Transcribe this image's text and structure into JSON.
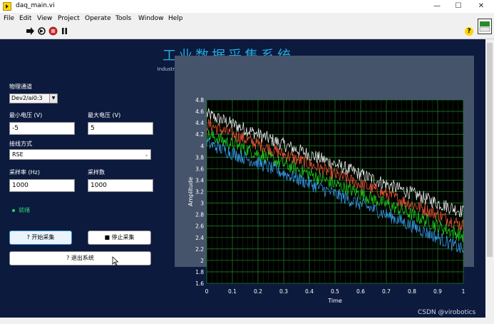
{
  "window": {
    "title": "daq_main.vi",
    "minimize": "—",
    "maximize": "☐",
    "close": "✕"
  },
  "menu": [
    "File",
    "Edit",
    "View",
    "Project",
    "Operate",
    "Tools",
    "Window",
    "Help"
  ],
  "toolbar": {
    "icons": [
      "run-arrow-icon",
      "run-continuously-icon",
      "abort-icon",
      "pause-icon"
    ],
    "help": "?"
  },
  "header": {
    "title": "工业数据采集系统",
    "subtitle": "Industrial DAQ System  |  DAQmx Analog Input"
  },
  "channel": {
    "label": "物理通道",
    "value": "Dev2/ai0:3"
  },
  "min_voltage": {
    "label": "最小电压 (V)",
    "value": "-5"
  },
  "max_voltage": {
    "label": "最大电压 (V)",
    "value": "5"
  },
  "terminal": {
    "label": "接线方式",
    "value": "RSE"
  },
  "sample_rate": {
    "label": "采样率 (Hz)",
    "value": "1000"
  },
  "samples": {
    "label": "采样数",
    "value": "1000"
  },
  "status": {
    "text": "就绪"
  },
  "buttons": {
    "start": "? 开始采集",
    "stop": "■ 停止采集",
    "exit": "? 退出系统"
  },
  "watermark": "CSDN @virobotics",
  "colors": {
    "panel_bg": "#0c1a3d",
    "title": "#26a9e0",
    "plot_bg": "#000000",
    "grid": "#1f7a2a"
  },
  "chart_data": {
    "type": "line",
    "title": "",
    "xlabel": "Time",
    "ylabel": "Amplitude",
    "xlim": [
      0,
      1
    ],
    "ylim": [
      1.6,
      4.8
    ],
    "xticks": [
      "0",
      "0.1",
      "0.2",
      "0.3",
      "0.4",
      "0.5",
      "0.6",
      "0.7",
      "0.8",
      "0.9",
      "1"
    ],
    "yticks": [
      "4.8",
      "4.6",
      "4.4",
      "4.2",
      "4",
      "3.8",
      "3.6",
      "3.4",
      "3.2",
      "3",
      "2.8",
      "2.6",
      "2.4",
      "2.2",
      "2",
      "1.8",
      "1.6"
    ],
    "grid": true,
    "noise": 0.12,
    "series": [
      {
        "color": "#ffffff",
        "x": [
          0,
          0.1,
          0.2,
          0.3,
          0.4,
          0.5,
          0.6,
          0.7,
          0.8,
          0.9,
          1
        ],
        "y": [
          4.55,
          4.38,
          4.2,
          4.02,
          3.85,
          3.68,
          3.5,
          3.33,
          3.17,
          3.0,
          2.85
        ]
      },
      {
        "color": "#ff5a3c",
        "x": [
          0,
          0.1,
          0.2,
          0.3,
          0.4,
          0.5,
          0.6,
          0.7,
          0.8,
          0.9,
          1
        ],
        "y": [
          4.38,
          4.2,
          4.03,
          3.85,
          3.68,
          3.5,
          3.33,
          3.15,
          2.98,
          2.8,
          2.6
        ]
      },
      {
        "color": "#22dd22",
        "x": [
          0,
          0.1,
          0.2,
          0.3,
          0.4,
          0.5,
          0.6,
          0.7,
          0.8,
          0.9,
          1
        ],
        "y": [
          4.2,
          4.03,
          3.86,
          3.68,
          3.51,
          3.33,
          3.16,
          2.98,
          2.8,
          2.6,
          2.42
        ]
      },
      {
        "color": "#3aa8ff",
        "x": [
          0,
          0.1,
          0.2,
          0.3,
          0.4,
          0.5,
          0.6,
          0.7,
          0.8,
          0.9,
          1
        ],
        "y": [
          4.05,
          3.87,
          3.7,
          3.52,
          3.34,
          3.16,
          2.98,
          2.8,
          2.6,
          2.4,
          2.18
        ]
      }
    ]
  }
}
